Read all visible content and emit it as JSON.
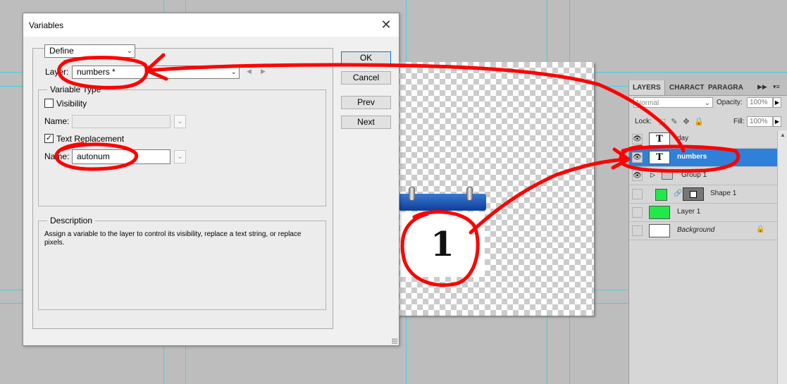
{
  "dialog": {
    "title": "Variables",
    "define_select": "Define",
    "layer_label": "Layer:",
    "layer_value": "numbers *",
    "variable_type_label": "Variable Type",
    "visibility_label": "Visibility",
    "visibility_checked": false,
    "visibility_name_label": "Name:",
    "visibility_name_value": "",
    "text_replacement_label": "Text Replacement",
    "text_replacement_checked": true,
    "text_name_label": "Name:",
    "text_name_value": "autonum",
    "description_label": "Description",
    "description_text": "Assign a variable to the layer to control its visibility, replace a text string, or replace pixels.",
    "buttons": {
      "ok": "OK",
      "cancel": "Cancel",
      "prev": "Prev",
      "next": "Next"
    }
  },
  "canvas": {
    "calendar_number": "1"
  },
  "layers_panel": {
    "tabs": [
      "LAYERS",
      "CHARACT",
      "PARAGRA"
    ],
    "blend_mode": "Normal",
    "opacity_label": "Opacity:",
    "opacity_value": "100%",
    "lock_label": "Lock:",
    "fill_label": "Fill:",
    "fill_value": "100%",
    "layers": [
      {
        "name": "day",
        "type": "text",
        "visible": true,
        "selected": false
      },
      {
        "name": "numbers",
        "type": "text",
        "visible": true,
        "selected": true
      },
      {
        "name": "Group 1",
        "type": "group",
        "visible": true,
        "selected": false
      },
      {
        "name": "Shape 1",
        "type": "shape",
        "visible": false,
        "selected": false
      },
      {
        "name": "Layer 1",
        "type": "pixel",
        "visible": false,
        "selected": false
      },
      {
        "name": "Background",
        "type": "background",
        "visible": false,
        "selected": false
      }
    ],
    "thumb_text": "T",
    "colors": {
      "selected_row": "#2f80d8",
      "layer_fill": "#22e84a"
    }
  },
  "annotation_color": "#ff0000"
}
